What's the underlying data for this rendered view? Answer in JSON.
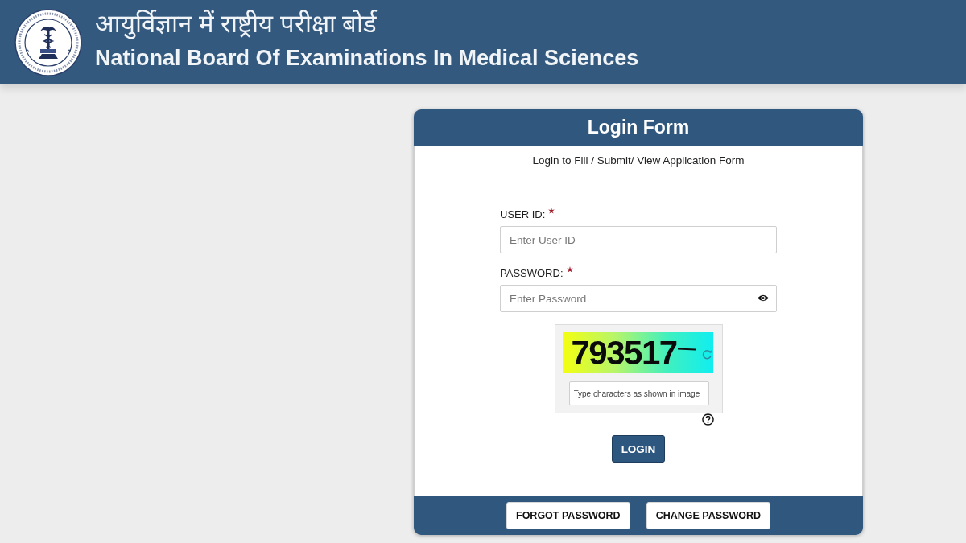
{
  "header": {
    "title_hindi": "आयुर्विज्ञान में राष्ट्रीय परीक्षा बोर्ड",
    "title": "National Board Of Examinations In Medical Sciences"
  },
  "login_form": {
    "title": "Login Form",
    "subtitle": "Login to Fill / Submit/ View Application Form",
    "fields": [
      {
        "kind": "text",
        "label": "USER ID:",
        "required": true,
        "placeholder": "Enter User ID"
      },
      {
        "kind": "password",
        "label": "PASSWORD:",
        "required": true,
        "placeholder": "Enter Password"
      }
    ],
    "captcha": {
      "code": "793517",
      "placeholder": "Type characters as shown in image"
    },
    "submit_button": "LOGIN",
    "footer_buttons": [
      "FORGOT PASSWORD",
      "CHANGE PASSWORD"
    ]
  }
}
